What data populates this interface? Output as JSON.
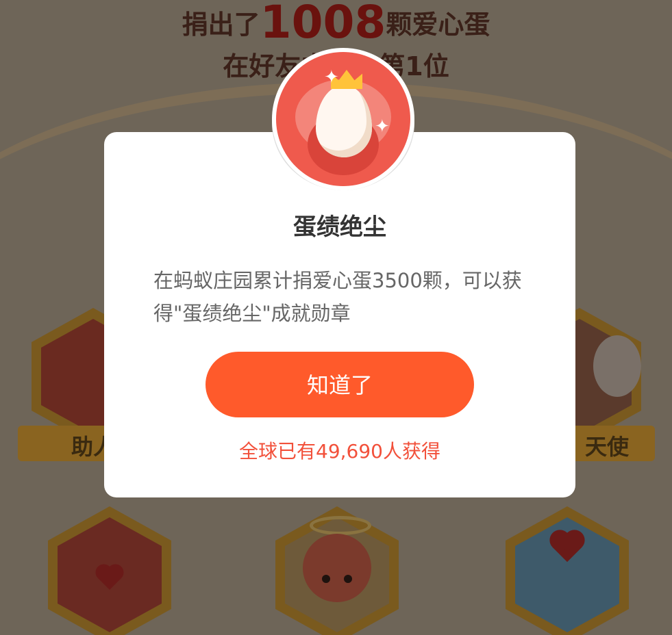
{
  "background": {
    "headline_prefix": "捐出了",
    "headline_number": "1008",
    "headline_suffix": "颗爱心蛋",
    "rank_text": "在好友中排名第1位",
    "badges": [
      {
        "label": "助人"
      },
      {
        "label": "天使"
      }
    ]
  },
  "modal": {
    "title": "蛋绩绝尘",
    "description": "在蚂蚁庄园累计捐爱心蛋3500颗，可以获得\"蛋绩绝尘\"成就勋章",
    "button_label": "知道了",
    "stat": "全球已有49,690人获得"
  },
  "icons": {
    "medal": "egg-crown-medal-icon",
    "sparkle": "sparkle-icon"
  },
  "colors": {
    "accent": "#ff5a2b",
    "stat_text": "#f2503a",
    "medal_bg": "#ef5a4d",
    "crown": "#ffc33a"
  }
}
